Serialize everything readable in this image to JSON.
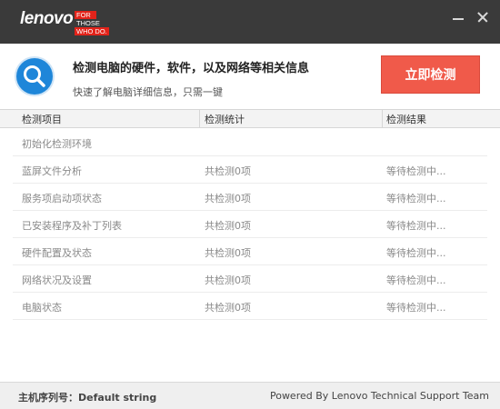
{
  "window": {
    "logo_word": "lenovo",
    "logo_tag": [
      "FOR",
      "THOSE",
      "WHO DO."
    ]
  },
  "header": {
    "title": "检测电脑的硬件，软件，以及网络等相关信息",
    "subtitle": "快速了解电脑详细信息，只需一键",
    "start_button": "立即检测",
    "accent_color": "#f05a4a",
    "icon_color": "#1e86d9"
  },
  "table": {
    "headers": [
      "检测项目",
      "检测统计",
      "检测结果"
    ],
    "rows": [
      {
        "item": "初始化检测环境",
        "stat": "",
        "result": ""
      },
      {
        "item": "蓝屏文件分析",
        "stat": "共检测0项",
        "result": "等待检测中..."
      },
      {
        "item": "服务项启动项状态",
        "stat": "共检测0项",
        "result": "等待检测中..."
      },
      {
        "item": "已安装程序及补丁列表",
        "stat": "共检测0项",
        "result": "等待检测中..."
      },
      {
        "item": "硬件配置及状态",
        "stat": "共检测0项",
        "result": "等待检测中..."
      },
      {
        "item": "网络状况及设置",
        "stat": "共检测0项",
        "result": "等待检测中..."
      },
      {
        "item": "电脑状态",
        "stat": "共检测0项",
        "result": "等待检测中..."
      }
    ]
  },
  "footer": {
    "serial": "主机序列号：Default string",
    "powered_by": "Powered By Lenovo Technical Support Team"
  }
}
